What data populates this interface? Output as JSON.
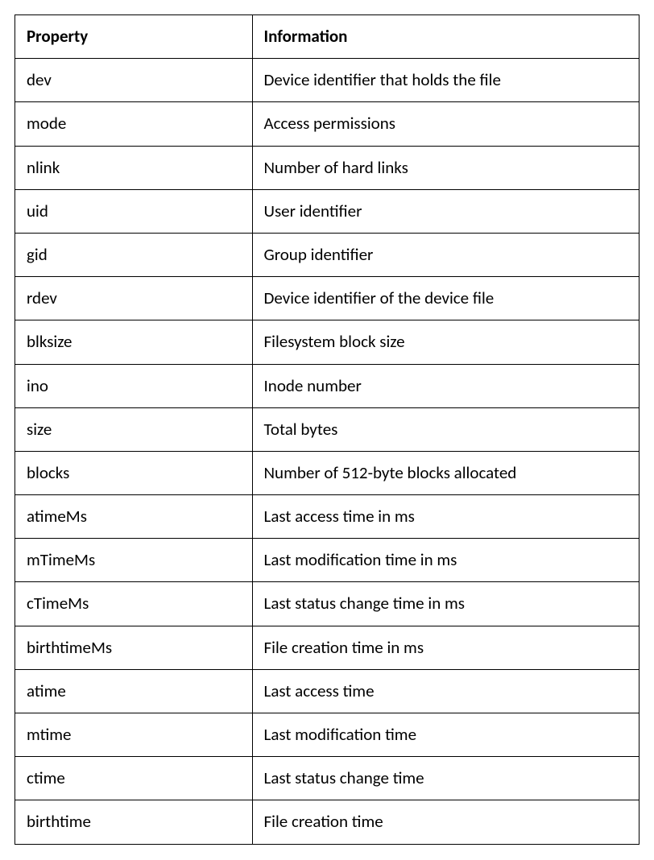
{
  "table": {
    "headers": {
      "property": "Property",
      "information": "Information"
    },
    "rows": [
      {
        "property": "dev",
        "information": "Device identifier that holds the file"
      },
      {
        "property": "mode",
        "information": "Access permissions"
      },
      {
        "property": "nlink",
        "information": "Number of hard links"
      },
      {
        "property": "uid",
        "information": "User identifier"
      },
      {
        "property": "gid",
        "information": "Group identifier"
      },
      {
        "property": "rdev",
        "information": "Device identifier of the device file"
      },
      {
        "property": "blksize",
        "information": "Filesystem block size"
      },
      {
        "property": "ino",
        "information": "Inode number"
      },
      {
        "property": "size",
        "information": "Total bytes"
      },
      {
        "property": "blocks",
        "information": "Number of 512-byte blocks allocated"
      },
      {
        "property": "atimeMs",
        "information": "Last access time in ms"
      },
      {
        "property": "mTimeMs",
        "information": "Last modification time in ms"
      },
      {
        "property": "cTimeMs",
        "information": "Last status change time in ms"
      },
      {
        "property": "birthtimeMs",
        "information": "File creation time in ms"
      },
      {
        "property": "atime",
        "information": "Last access time"
      },
      {
        "property": "mtime",
        "information": "Last modification time"
      },
      {
        "property": "ctime",
        "information": "Last status change time"
      },
      {
        "property": "birthtime",
        "information": "File creation time"
      }
    ]
  }
}
